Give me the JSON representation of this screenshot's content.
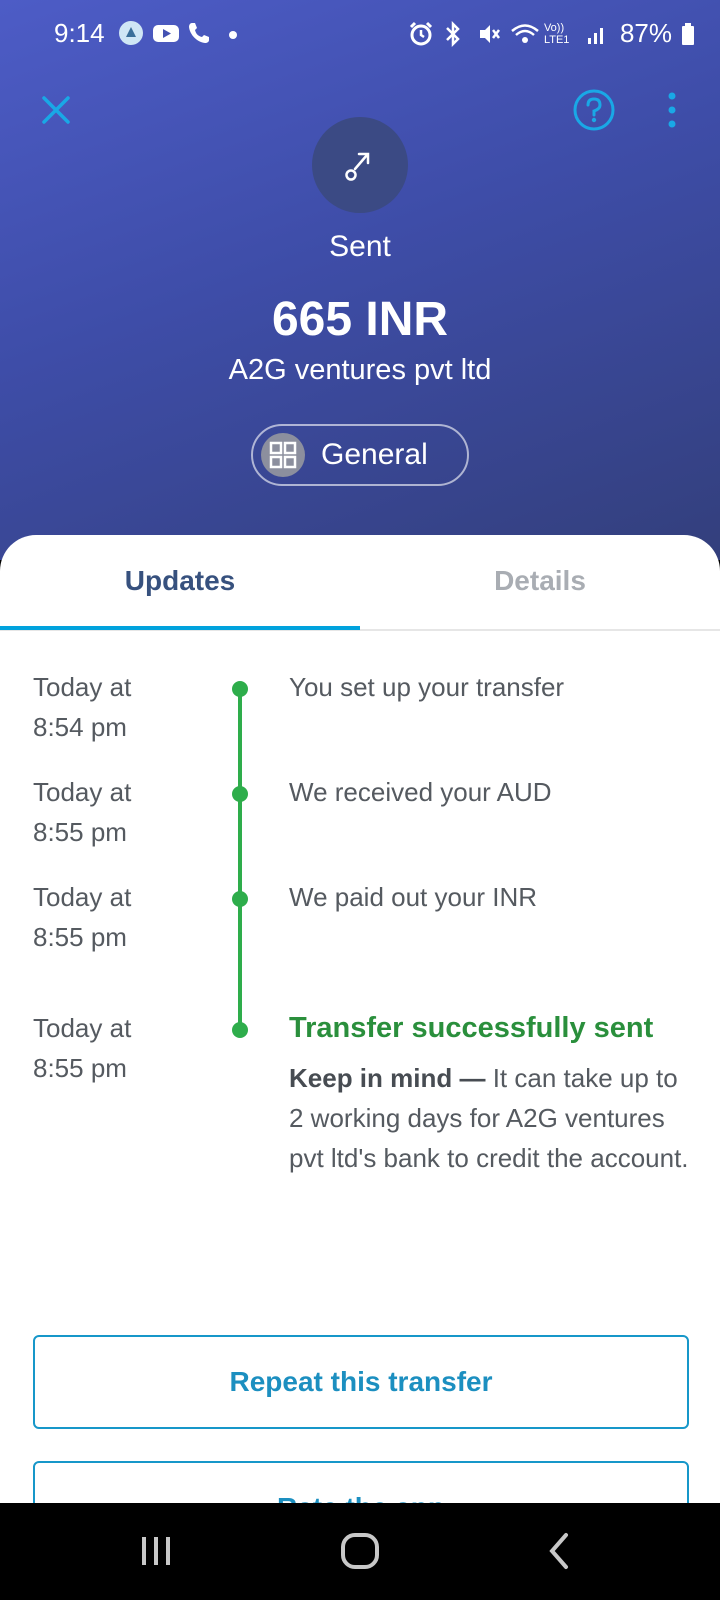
{
  "status_bar": {
    "time": "9:14",
    "battery": "87%",
    "network_label": "Vo)) LTE1"
  },
  "header": {
    "status": "Sent",
    "amount": "665 INR",
    "recipient": "A2G ventures pvt ltd",
    "category": "General"
  },
  "tabs": [
    {
      "label": "Updates",
      "active": true
    },
    {
      "label": "Details",
      "active": false
    }
  ],
  "timeline": [
    {
      "time_line1": "Today at",
      "time_line2": "8:54 pm",
      "text": "You set up your transfer"
    },
    {
      "time_line1": "Today at",
      "time_line2": "8:55 pm",
      "text": "We received your AUD"
    },
    {
      "time_line1": "Today at",
      "time_line2": "8:55 pm",
      "text": "We paid out your INR"
    },
    {
      "time_line1": "Today at",
      "time_line2": "8:55 pm",
      "text": "Transfer successfully sent",
      "note_lead": "Keep in mind —",
      "note_body": "It can take up to 2 working days for A2G ventures pvt ltd's bank to credit the account."
    }
  ],
  "actions": {
    "repeat_label": "Repeat this transfer",
    "rate_label": "Rate the app"
  },
  "colors": {
    "accent": "#00a2dd",
    "success": "#2ead4b",
    "header_top": "#4d5cc6",
    "header_bottom": "#333f7c"
  },
  "icons": {
    "close": "close-icon",
    "help": "help-icon",
    "more": "more-vertical-icon",
    "sent": "arrow-up-right-icon",
    "category": "grid-icon"
  }
}
